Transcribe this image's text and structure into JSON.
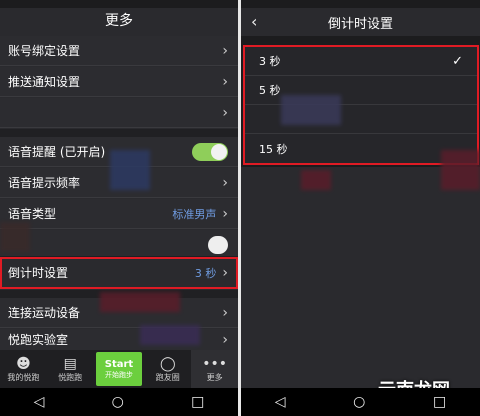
{
  "left": {
    "title": "更多",
    "items": [
      {
        "label": "账号绑定设置"
      },
      {
        "label": "推送通知设置"
      },
      {
        "label": ""
      },
      {
        "label": "语音提醒 (已开启)",
        "toggle": true
      },
      {
        "label": "语音提示频率"
      },
      {
        "label": "语音类型",
        "value": "标准男声"
      },
      {
        "label": ""
      },
      {
        "label": "倒计时设置",
        "value": "3 秒"
      },
      {
        "label": "连接运动设备"
      },
      {
        "label": "悦跑实验室"
      }
    ],
    "tabs": [
      {
        "icon": "user-icon",
        "label": "我的悦跑"
      },
      {
        "icon": "book-icon",
        "label": "悦跑跑"
      },
      {
        "icon": "start",
        "label_top": "Start",
        "label_bottom": "开始跑步"
      },
      {
        "icon": "chat-icon",
        "label": "跑友圈"
      },
      {
        "icon": "more-icon",
        "label": "更多"
      }
    ]
  },
  "right": {
    "title": "倒计时设置",
    "options": [
      {
        "label": "3 秒",
        "selected": true
      },
      {
        "label": "5 秒",
        "selected": false
      },
      {
        "label": "",
        "selected": false
      },
      {
        "label": "15 秒",
        "selected": false
      }
    ],
    "watermark": "云南龙网"
  },
  "colors": {
    "accent_red": "#e01b24",
    "toggle_green": "#8fce5a",
    "value_blue": "#6f9be0",
    "start_green": "#6ccf3e"
  }
}
